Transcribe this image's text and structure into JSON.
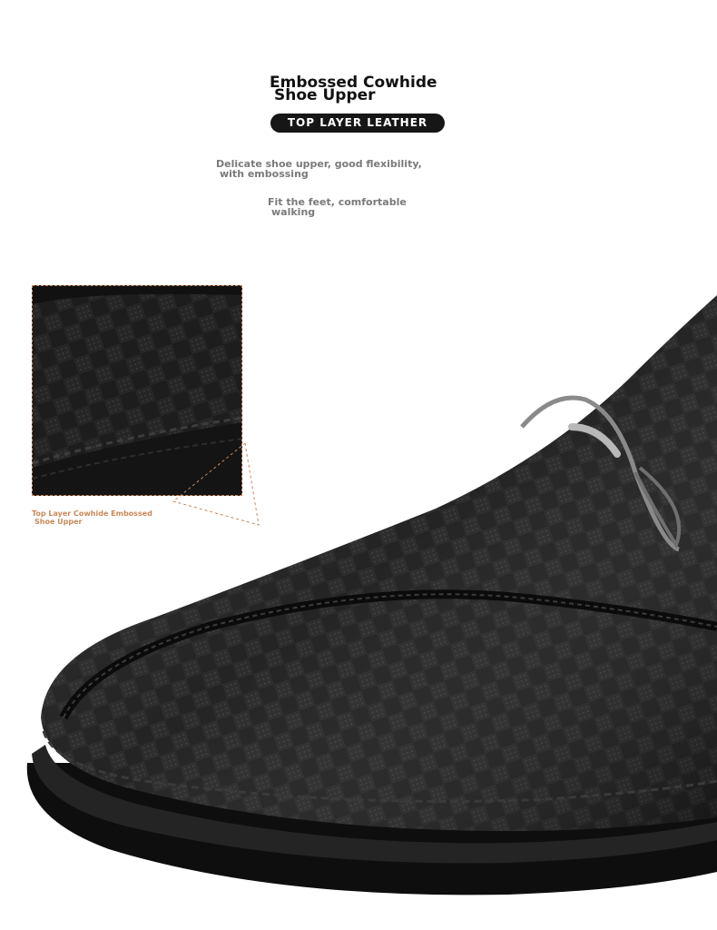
{
  "heading": {
    "line1": "Embossed Cowhide",
    "line2": "Shoe Upper"
  },
  "badge": "TOP LAYER LEATHER",
  "features": [
    {
      "line1": "Delicate shoe upper, good flexibility,",
      "line2": "with embossing"
    },
    {
      "line1": "Fit the feet, comfortable",
      "line2": "walking"
    }
  ],
  "detail": {
    "caption_line1": "Top Layer Cowhide Embossed",
    "caption_line2": "Shoe Upper"
  },
  "colors": {
    "accent": "#c9895a",
    "leather": "#1c1c1c",
    "badge_bg": "#161616"
  }
}
